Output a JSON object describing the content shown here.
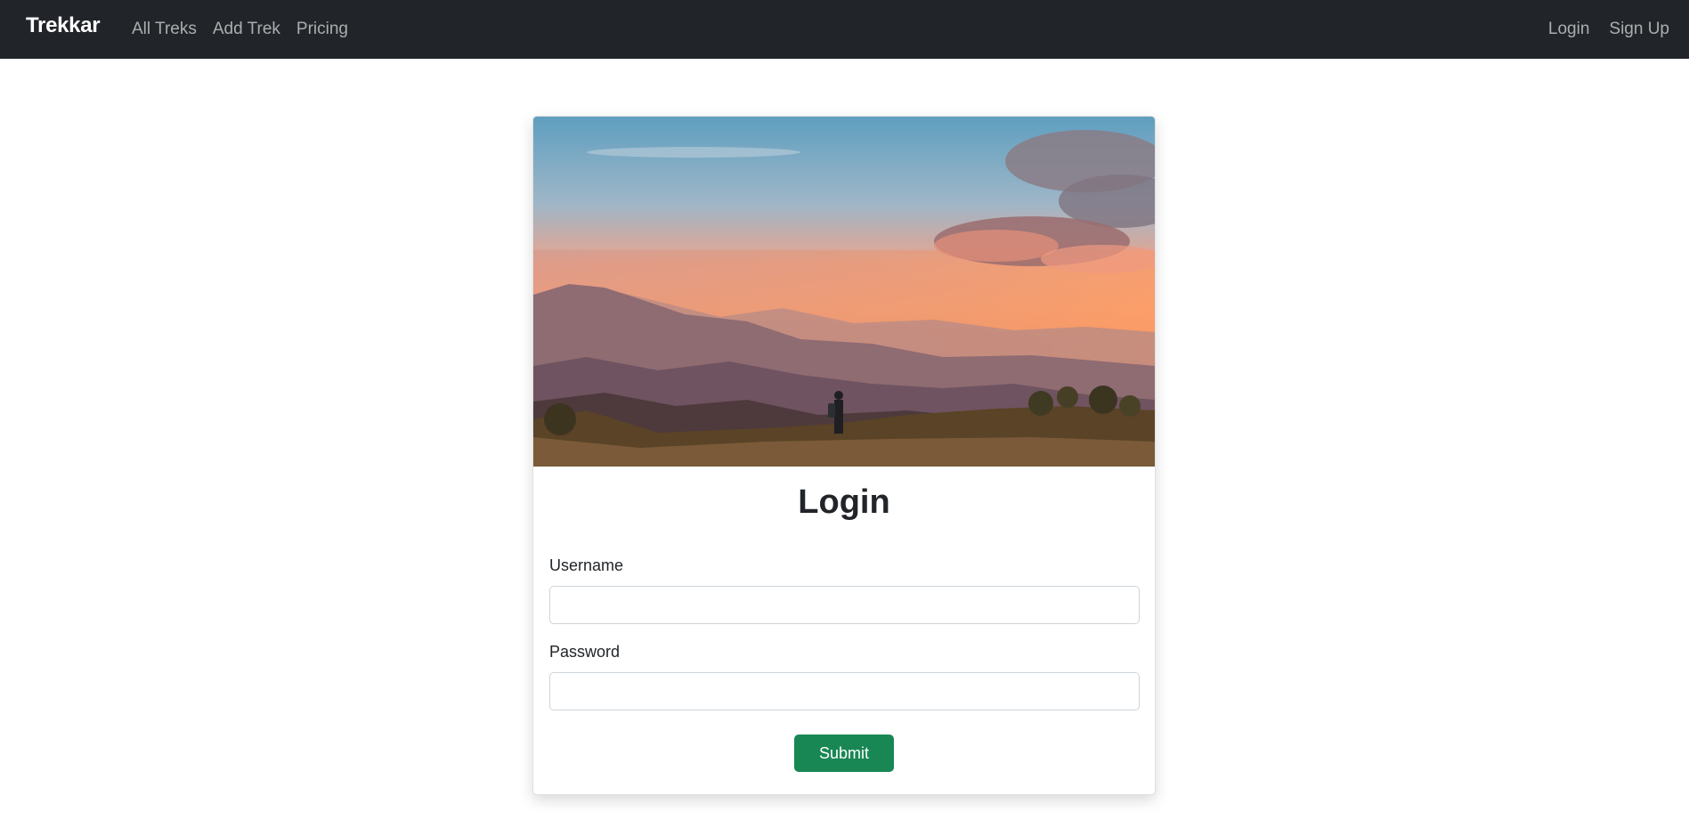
{
  "navbar": {
    "brand": "Trekkar",
    "left_links": [
      "All Treks",
      "Add Trek",
      "Pricing"
    ],
    "right_links": [
      "Login",
      "Sign Up"
    ]
  },
  "card": {
    "image_name": "mountain-sunset-hiker-image",
    "title": "Login",
    "username_label": "Username",
    "username_value": "",
    "password_label": "Password",
    "password_value": "",
    "submit_label": "Submit"
  },
  "colors": {
    "navbar_bg": "#212529",
    "nav_link": "rgba(255,255,255,0.62)",
    "brand": "#ffffff",
    "submit_bg": "#198754"
  }
}
